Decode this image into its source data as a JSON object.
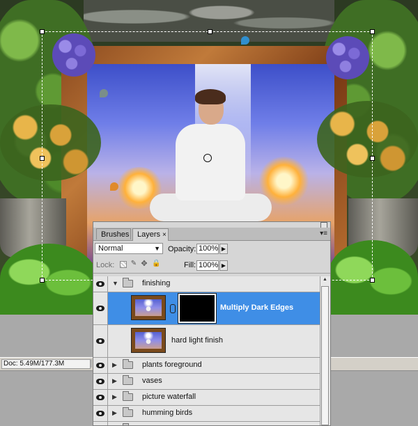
{
  "status_bar": {
    "doc_info": "Doc: 5.49M/177.3M"
  },
  "layers_panel": {
    "tabs": [
      {
        "label": "Brushes",
        "active": false
      },
      {
        "label": "Layers",
        "active": true
      }
    ],
    "tab_close_glyph": "×",
    "menu_glyph": "▾≡",
    "collapse_glyph": "▸",
    "blend_mode": "Normal",
    "blend_arrow": "▼",
    "opacity_label": "Opacity:",
    "opacity_value": "100%",
    "lock_label": "Lock:",
    "fill_label": "Fill:",
    "fill_value": "100%",
    "spin_arrow": "▶",
    "scroll_up_glyph": "▲",
    "lock_image_glyph": "✎",
    "lock_position_glyph": "✥",
    "lock_all_glyph": "🔒",
    "expanded_glyph": "▼",
    "collapsed_glyph": "▶",
    "layers": [
      {
        "name": "finishing",
        "type": "group",
        "expanded": true,
        "visible": true
      },
      {
        "name": "Multiply Dark Edges",
        "type": "layer-with-mask",
        "selected": true,
        "visible": true
      },
      {
        "name": "hard light finish",
        "type": "layer",
        "visible": true
      },
      {
        "name": "plants foreground",
        "type": "group",
        "expanded": false,
        "visible": true
      },
      {
        "name": "vases",
        "type": "group",
        "expanded": false,
        "visible": true
      },
      {
        "name": "picture waterfall",
        "type": "group",
        "expanded": false,
        "visible": true
      },
      {
        "name": "humming birds",
        "type": "group",
        "expanded": false,
        "visible": true
      }
    ]
  },
  "icons": {
    "visibility": "eye-icon",
    "folder": "folder-icon",
    "mask_link": "chain-link-icon",
    "panel_menu": "panel-menu-icon"
  },
  "colors": {
    "selection": "#3f8ee6",
    "panel_bg": "#d6d6d6",
    "workspace_bg": "#a9a9a9"
  }
}
